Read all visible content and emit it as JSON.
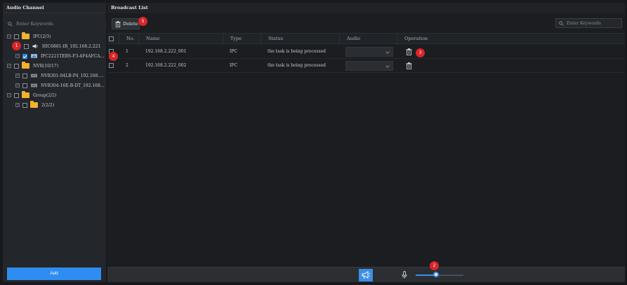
{
  "left_panel": {
    "title": "Audio Channel",
    "search_placeholder": "Enter Keywords",
    "tree": [
      {
        "level": 0,
        "type": "folder",
        "label": "IPC(2/3)",
        "checked": false
      },
      {
        "level": 1,
        "type": "speaker",
        "label": "HIC6881-IR_192.168.2.221",
        "checked": false
      },
      {
        "level": 1,
        "type": "camera",
        "label": "IPC2221TEBS-F3-4F4AFCA_1…",
        "checked": true
      },
      {
        "level": 0,
        "type": "folder",
        "label": "NVR(10/17)",
        "checked": false
      },
      {
        "level": 1,
        "type": "nvr",
        "label": "NVR301-04LB-P4_192.168.2…",
        "checked": false
      },
      {
        "level": 1,
        "type": "nvr",
        "label": "NVR304-16E-B-DT_192.168…",
        "checked": false
      },
      {
        "level": 0,
        "type": "folder",
        "label": "Group(2/2)",
        "checked": false
      },
      {
        "level": 1,
        "type": "folder",
        "label": "2(2/2)",
        "checked": false
      }
    ],
    "add_label": "Add"
  },
  "right_panel": {
    "title": "Broadcast List",
    "delete_label": "Delete",
    "search_placeholder": "Enter Keywords",
    "columns": [
      "No.",
      "Name",
      "Type",
      "Status",
      "Audio",
      "Operation"
    ],
    "rows": [
      {
        "no": "1",
        "name": "192.168.2.222_001",
        "type": "IPC",
        "status": "the task is being processed"
      },
      {
        "no": "2",
        "name": "192.168.2.222_002",
        "type": "IPC",
        "status": "the task is being processed"
      }
    ]
  },
  "volume": {
    "level": 0.42
  },
  "markers": [
    "1",
    "2",
    "3",
    "4",
    "5"
  ],
  "colors": {
    "accent": "#2f8cf0",
    "marker": "#d9252a",
    "folder": "#f2b22e"
  },
  "icons": [
    "search-icon",
    "folder-icon",
    "speaker-icon",
    "camera-icon",
    "nvr-icon",
    "trash-icon",
    "broadcast-icon",
    "microphone-icon"
  ]
}
